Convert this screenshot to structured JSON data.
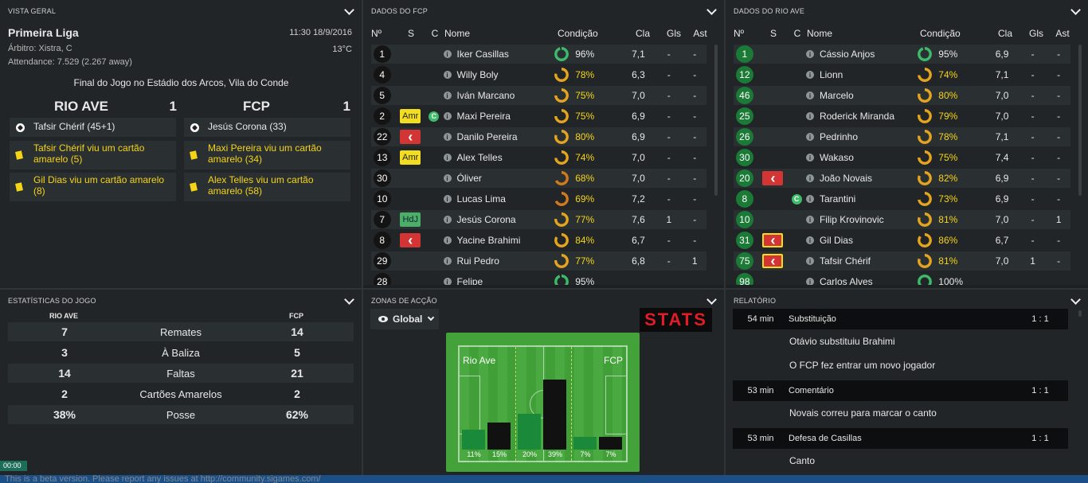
{
  "overview": {
    "header": "VISTA GERAL",
    "competition": "Primeira Liga",
    "datetime": "11:30 18/9/2016",
    "referee": "Árbitro: Xistra, C",
    "temperature": "13°C",
    "attendance": "Attendance: 7.529 (2.267 away)",
    "final": "Final do Jogo no Estádio dos Arcos, Vila do Conde",
    "home": {
      "name": "RIO AVE",
      "score": "1",
      "events": [
        {
          "type": "goal",
          "text": "Tafsir Chérif (45+1)"
        },
        {
          "type": "yellow",
          "text": "Tafsir Chérif viu um cartão amarelo (5)"
        },
        {
          "type": "yellow",
          "text": "Gil Dias viu um cartão amarelo (8)"
        }
      ]
    },
    "away": {
      "name": "FCP",
      "score": "1",
      "events": [
        {
          "type": "goal",
          "text": "Jesús Corona (33)"
        },
        {
          "type": "yellow",
          "text": "Maxi Pereira viu um cartão amarelo (34)"
        },
        {
          "type": "yellow",
          "text": "Alex Telles viu um cartão amarelo (58)"
        }
      ]
    }
  },
  "squad_cols": {
    "no": "Nº",
    "s": "S",
    "c": "C",
    "name": "Nome",
    "cond": "Condição",
    "cla": "Cla",
    "gls": "Gls",
    "ast": "Ast"
  },
  "fcp": {
    "header": "DADOS DO FCP",
    "rows": [
      {
        "no": "1",
        "s": "",
        "c": "",
        "name": "Iker Casillas",
        "cond": "96%",
        "cond_val": 96,
        "cla": "7,1",
        "gls": "-",
        "ast": "-"
      },
      {
        "no": "4",
        "s": "",
        "c": "",
        "name": "Willy Boly",
        "cond": "78%",
        "cond_val": 78,
        "cla": "6,3",
        "gls": "-",
        "ast": "-"
      },
      {
        "no": "5",
        "s": "",
        "c": "",
        "name": "Iván Marcano",
        "cond": "75%",
        "cond_val": 75,
        "cla": "7,0",
        "gls": "-",
        "ast": "-"
      },
      {
        "no": "2",
        "s": "Amr",
        "c": "C",
        "name": "Maxi Pereira",
        "cond": "75%",
        "cond_val": 75,
        "cla": "6,9",
        "gls": "-",
        "ast": "-"
      },
      {
        "no": "22",
        "s": "sub",
        "c": "",
        "name": "Danilo Pereira",
        "cond": "80%",
        "cond_val": 80,
        "cla": "6,9",
        "gls": "-",
        "ast": "-"
      },
      {
        "no": "13",
        "s": "Amr",
        "c": "",
        "name": "Alex Telles",
        "cond": "74%",
        "cond_val": 74,
        "cla": "7,0",
        "gls": "-",
        "ast": "-"
      },
      {
        "no": "30",
        "s": "",
        "c": "",
        "name": "Óliver",
        "cond": "68%",
        "cond_val": 68,
        "cla": "7,0",
        "gls": "-",
        "ast": "-"
      },
      {
        "no": "10",
        "s": "",
        "c": "",
        "name": "Lucas Lima",
        "cond": "69%",
        "cond_val": 69,
        "cla": "7,2",
        "gls": "-",
        "ast": "-"
      },
      {
        "no": "7",
        "s": "HdJ",
        "c": "",
        "name": "Jesús Corona",
        "cond": "77%",
        "cond_val": 77,
        "cla": "7,6",
        "gls": "1",
        "ast": "-"
      },
      {
        "no": "8",
        "s": "sub",
        "c": "",
        "name": "Yacine Brahimi",
        "cond": "84%",
        "cond_val": 84,
        "cla": "6,7",
        "gls": "-",
        "ast": "-"
      },
      {
        "no": "29",
        "s": "",
        "c": "",
        "name": "Rui Pedro",
        "cond": "77%",
        "cond_val": 77,
        "cla": "6,8",
        "gls": "-",
        "ast": "1"
      },
      {
        "no": "28",
        "s": "",
        "c": "",
        "name": "Felipe",
        "cond": "95%",
        "cond_val": 95,
        "cla": "",
        "gls": "",
        "ast": ""
      }
    ]
  },
  "rioave": {
    "header": "DADOS DO RIO AVE",
    "rows": [
      {
        "no": "1",
        "s": "",
        "c": "",
        "name": "Cássio Anjos",
        "cond": "95%",
        "cond_val": 95,
        "cla": "6,9",
        "gls": "-",
        "ast": "-"
      },
      {
        "no": "12",
        "s": "",
        "c": "",
        "name": "Lionn",
        "cond": "74%",
        "cond_val": 74,
        "cla": "7,1",
        "gls": "-",
        "ast": "-"
      },
      {
        "no": "46",
        "s": "",
        "c": "",
        "name": "Marcelo",
        "cond": "80%",
        "cond_val": 80,
        "cla": "7,0",
        "gls": "-",
        "ast": "-"
      },
      {
        "no": "25",
        "s": "",
        "c": "",
        "name": "Roderick Miranda",
        "cond": "79%",
        "cond_val": 79,
        "cla": "7,0",
        "gls": "-",
        "ast": "-"
      },
      {
        "no": "26",
        "s": "",
        "c": "",
        "name": "Pedrinho",
        "cond": "78%",
        "cond_val": 78,
        "cla": "7,1",
        "gls": "-",
        "ast": "-"
      },
      {
        "no": "30",
        "s": "",
        "c": "",
        "name": "Wakaso",
        "cond": "75%",
        "cond_val": 75,
        "cla": "7,4",
        "gls": "-",
        "ast": "-"
      },
      {
        "no": "20",
        "s": "sub",
        "c": "",
        "name": "João Novais",
        "cond": "82%",
        "cond_val": 82,
        "cla": "6,9",
        "gls": "-",
        "ast": "-"
      },
      {
        "no": "8",
        "s": "",
        "c": "C",
        "name": "Tarantini",
        "cond": "73%",
        "cond_val": 73,
        "cla": "6,9",
        "gls": "-",
        "ast": "-"
      },
      {
        "no": "10",
        "s": "",
        "c": "",
        "name": "Filip Krovinovic",
        "cond": "81%",
        "cond_val": 81,
        "cla": "7,0",
        "gls": "-",
        "ast": "1"
      },
      {
        "no": "31",
        "s": "subY",
        "c": "",
        "name": "Gil Dias",
        "cond": "86%",
        "cond_val": 86,
        "cla": "6,7",
        "gls": "-",
        "ast": "-"
      },
      {
        "no": "75",
        "s": "subY",
        "c": "",
        "name": "Tafsir Chérif",
        "cond": "81%",
        "cond_val": 81,
        "cla": "7,0",
        "gls": "1",
        "ast": "-"
      },
      {
        "no": "98",
        "s": "",
        "c": "",
        "name": "Carlos Alves",
        "cond": "100%",
        "cond_val": 100,
        "cla": "",
        "gls": "",
        "ast": ""
      }
    ]
  },
  "stats": {
    "header": "ESTATÍSTICAS DO JOGO",
    "home": "RIO AVE",
    "away": "FCP",
    "rows": [
      {
        "l": "7",
        "label": "Remates",
        "r": "14"
      },
      {
        "l": "3",
        "label": "À Baliza",
        "r": "5"
      },
      {
        "l": "14",
        "label": "Faltas",
        "r": "21"
      },
      {
        "l": "2",
        "label": "Cartões Amarelos",
        "r": "2"
      },
      {
        "l": "38%",
        "label": "Posse",
        "r": "62%"
      }
    ]
  },
  "zones": {
    "header": "ZONAS DE ACÇÃO",
    "view": "Global",
    "logo": "STATS",
    "home": "Rio Ave",
    "away": "FCP",
    "values": [
      {
        "home": 11,
        "away": 15,
        "home_lbl": "11%",
        "away_lbl": "15%"
      },
      {
        "home": 20,
        "away": 39,
        "home_lbl": "20%",
        "away_lbl": "39%"
      },
      {
        "home": 7,
        "away": 7,
        "home_lbl": "7%",
        "away_lbl": "7%"
      }
    ],
    "colors": {
      "home": "#1a8a3a",
      "away": "#111111"
    }
  },
  "report": {
    "header": "RELATÓRIO",
    "blocks": [
      {
        "min": "54 min",
        "type": "Substituição",
        "score": "1 : 1",
        "lines": [
          "Otávio substituiu Brahimi",
          "O FCP fez entrar um novo jogador"
        ]
      },
      {
        "min": "53 min",
        "type": "Comentário",
        "score": "1 : 1",
        "lines": [
          "Novais correu para marcar o canto"
        ]
      },
      {
        "min": "53 min",
        "type": "Defesa de Casillas",
        "score": "1 : 1",
        "lines": [
          "Canto"
        ]
      }
    ]
  },
  "clock": "00:00",
  "footer": "This is a beta version. Please report any issues at http://community.sigames.com/"
}
